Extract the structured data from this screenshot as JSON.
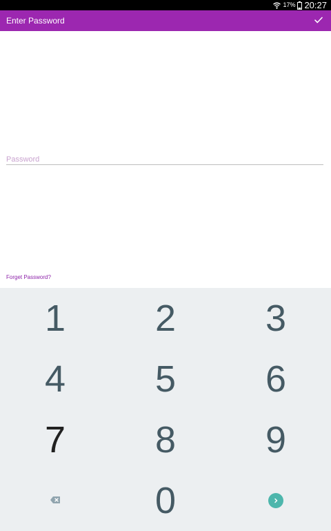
{
  "status_bar": {
    "battery_percent": "17%",
    "time": "20:27"
  },
  "app_bar": {
    "title": "Enter Password",
    "confirm_icon": "check-icon"
  },
  "password_field": {
    "placeholder": "Password",
    "value": ""
  },
  "forgot_link": "Forget Password?",
  "keypad": {
    "keys": [
      "1",
      "2",
      "3",
      "4",
      "5",
      "6",
      "7",
      "8",
      "9",
      "0"
    ],
    "backspace_icon": "backspace-icon",
    "enter_icon": "arrow-right-icon"
  },
  "colors": {
    "app_bar": "#9c27b0",
    "accent": "#8e24aa",
    "keypad_bg": "#eceff1",
    "enter_button": "#4db6ac"
  }
}
